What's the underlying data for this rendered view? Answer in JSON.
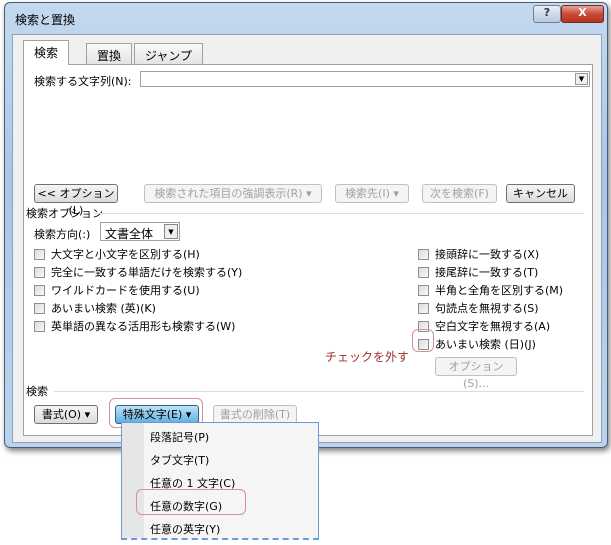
{
  "window": {
    "title": "検索と置換",
    "help": "?",
    "close": "X"
  },
  "tabs": [
    {
      "label": "検索"
    },
    {
      "label": "置換"
    },
    {
      "label": "ジャンプ"
    }
  ],
  "find": {
    "label": "検索する文字列(N):",
    "value": ""
  },
  "buttons": {
    "options": "<< オプション(L)",
    "highlight": "検索された項目の強調表示(R) ▾",
    "find_in": "検索先(I) ▾",
    "find_next": "次を検索(F)",
    "cancel": "キャンセル"
  },
  "search_options": {
    "title": "検索オプション",
    "direction_label": "検索方向(:)",
    "direction_value": "文書全体",
    "left": [
      {
        "label": "大文字と小文字を区別する(H)"
      },
      {
        "label": "完全に一致する単語だけを検索する(Y)"
      },
      {
        "label": "ワイルドカードを使用する(U)"
      },
      {
        "label": "あいまい検索 (英)(K)"
      },
      {
        "label": "英単語の異なる活用形も検索する(W)"
      }
    ],
    "right": [
      {
        "label": "接頭辞に一致する(X)"
      },
      {
        "label": "接尾辞に一致する(T)"
      },
      {
        "label": "半角と全角を区別する(M)"
      },
      {
        "label": "句読点を無視する(S)"
      },
      {
        "label": "空白文字を無視する(A)"
      },
      {
        "label": "あいまい検索 (日)(J)"
      }
    ],
    "fuzzy_options": "オプション(S)..."
  },
  "annotation": "チェックを外す",
  "search_section": {
    "title": "検索",
    "format": "書式(O) ▾",
    "special": "特殊文字(E) ▾",
    "clear": "書式の削除(T)"
  },
  "special_menu": [
    {
      "label": "段落記号(P)"
    },
    {
      "label": "タブ文字(T)"
    },
    {
      "label": "任意の 1 文字(C)"
    },
    {
      "label": "任意の数字(G)"
    },
    {
      "label": "任意の英字(Y)"
    }
  ]
}
